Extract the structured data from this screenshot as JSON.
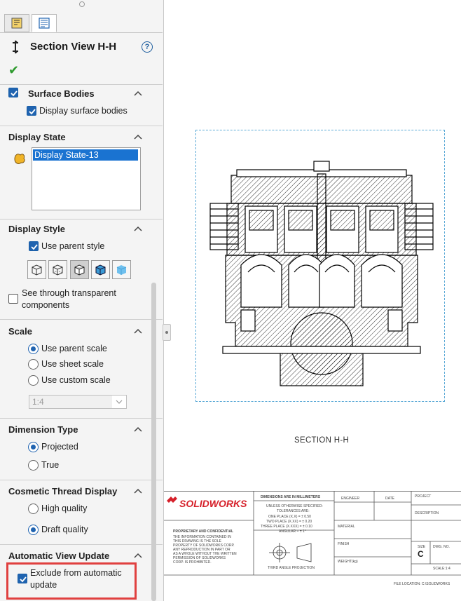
{
  "panel": {
    "title": "Section View H-H",
    "help_label": "?",
    "sections": {
      "surface_bodies": {
        "title": "Surface Bodies",
        "display_surface_bodies": "Display surface bodies"
      },
      "display_state": {
        "title": "Display State",
        "selected": "Display State-13"
      },
      "display_style": {
        "title": "Display Style",
        "use_parent_style": "Use parent style"
      },
      "see_through": {
        "line1": "See through transparent",
        "line2": "components"
      },
      "scale": {
        "title": "Scale",
        "use_parent_scale": "Use parent scale",
        "use_sheet_scale": "Use sheet scale",
        "use_custom_scale": "Use custom scale",
        "custom_value": "1:4"
      },
      "dimension_type": {
        "title": "Dimension Type",
        "projected": "Projected",
        "true": "True"
      },
      "cosmetic_thread": {
        "title": "Cosmetic Thread Display",
        "high_quality": "High quality",
        "draft_quality": "Draft quality"
      },
      "auto_update": {
        "title": "Automatic View Update",
        "line1": "Exclude from automatic",
        "line2": "update"
      }
    }
  },
  "sheet": {
    "section_label": "SECTION H-H",
    "title_block": {
      "logo": "SOLIDWORKS",
      "dims_header": "DIMENSIONS ARE IN MILLIMETERS",
      "tol1": "UNLESS OTHERWISE SPECIFIED:",
      "tol2": "TOLERANCES ARE:",
      "tol3": "ONE PLACE (X.X) = ± 0.50",
      "tol4": "TWO PLACE (X.XX) = ± 0.20",
      "tol5": "THREE PLACE (X.XXX) = ± 0.10",
      "tol6": "ANGULAR = ± 1°",
      "projection": "THIRD ANGLE PROJECTION",
      "engineer": "ENGINEER",
      "date": "DATE",
      "project": "PROJECT",
      "description": "DESCRIPTION",
      "material": "MATERIAL",
      "finish": "FINISH",
      "weight": "WEIGHT(kg)",
      "size": "SIZE",
      "size_val": "C",
      "dwg_no": "DWG. NO.",
      "scale": "SCALE:1:4",
      "prop_title": "PROPRIETARY AND CONFIDENTIAL",
      "prop1": "THE INFORMATION CONTAINED IN",
      "prop2": "THIS DRAWING IS THE SOLE",
      "prop3": "PROPERTY OF SOLIDWORKS CORP.",
      "prop4": "ANY REPRODUCTION IN PART OR",
      "prop5": "AS A WHOLE WITHOUT THE WRITTEN",
      "prop6": "PERMISSION OF SOLIDWORKS",
      "prop7": "CORP. IS PROHIBITED.",
      "file_location": "FILE LOCATION: C:\\SOLIDWORKS"
    }
  },
  "colors": {
    "accent": "#1f63b0",
    "highlight_box": "#e0403f",
    "ok_check": "#2e9a2e",
    "selection": "#1a73d1",
    "view_border": "#5aa9d6"
  }
}
